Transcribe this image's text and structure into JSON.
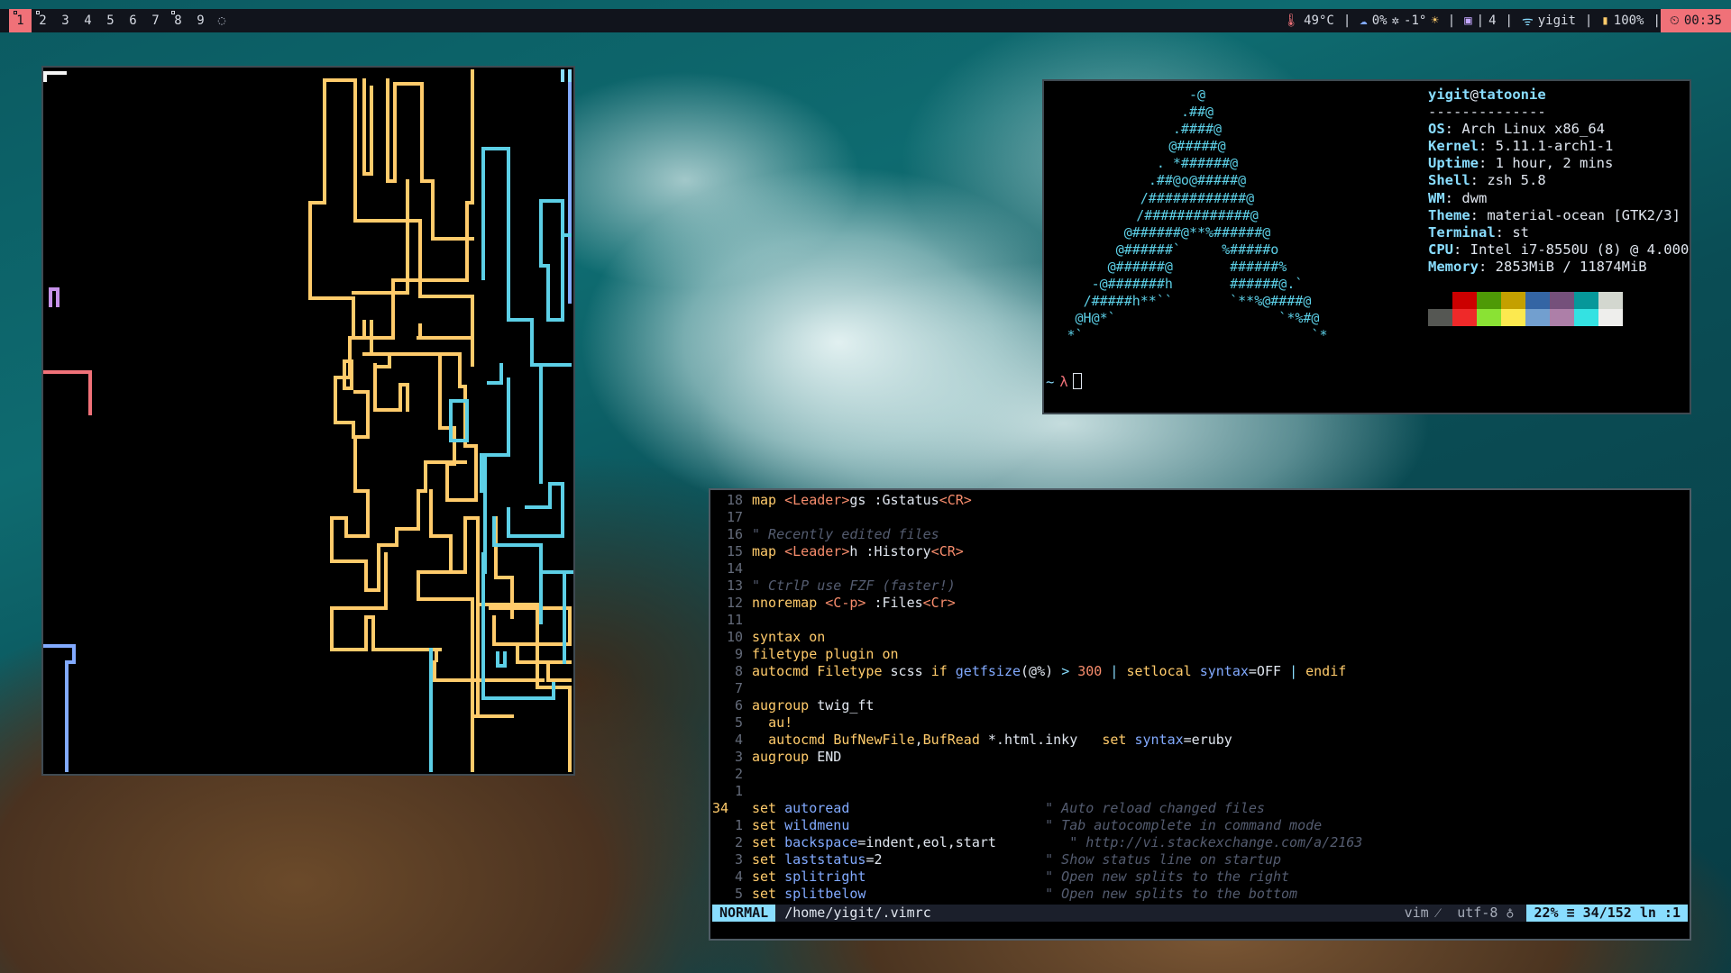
{
  "topbar": {
    "tags": [
      {
        "label": "1",
        "active": true,
        "occupied": true
      },
      {
        "label": "2",
        "active": false,
        "occupied": true
      },
      {
        "label": "3",
        "active": false,
        "occupied": false
      },
      {
        "label": "4",
        "active": false,
        "occupied": false
      },
      {
        "label": "5",
        "active": false,
        "occupied": false
      },
      {
        "label": "6",
        "active": false,
        "occupied": false
      },
      {
        "label": "7",
        "active": false,
        "occupied": false
      },
      {
        "label": "8",
        "active": false,
        "occupied": true
      },
      {
        "label": "9",
        "active": false,
        "occupied": false
      }
    ],
    "layout_symbol": "◌",
    "temp": "49°C",
    "cpu": "0%",
    "weather_temp": "-1°",
    "volume": "4",
    "wifi": "yigit",
    "battery": "100%",
    "clock": "00:35",
    "separator": "|"
  },
  "neofetch": {
    "logo": [
      "-@",
      ".##@",
      ".####@",
      "@#####@",
      ". *######@",
      ".##@o@#####@",
      "/############@",
      "/#############@",
      "@######@**%######@",
      "@######`     %#####o",
      "@######@       ######%",
      "-@#######h       ######@.`",
      "/#####h**``       `**%@####@",
      "@H@*`                    `*%#@",
      "*`                            `*"
    ],
    "user": "yigit",
    "at": "@",
    "host": "tatoonie",
    "underline": "--------------",
    "fields": [
      {
        "key": "OS",
        "value": "Arch Linux x86_64"
      },
      {
        "key": "Kernel",
        "value": "5.11.1-arch1-1"
      },
      {
        "key": "Uptime",
        "value": "1 hour, 2 mins"
      },
      {
        "key": "Shell",
        "value": "zsh 5.8"
      },
      {
        "key": "WM",
        "value": "dwm"
      },
      {
        "key": "Theme",
        "value": "material-ocean [GTK2/3]"
      },
      {
        "key": "Terminal",
        "value": "st"
      },
      {
        "key": "CPU",
        "value": "Intel i7-8550U (8) @ 4.000"
      },
      {
        "key": "Memory",
        "value": "2853MiB / 11874MiB"
      }
    ],
    "palette_top": [
      "#000000",
      "#cc0000",
      "#4e9a06",
      "#c4a000",
      "#3465a4",
      "#75507b",
      "#06989a",
      "#d3d7cf"
    ],
    "palette_bottom": [
      "#555753",
      "#ef2929",
      "#8ae234",
      "#fce94f",
      "#729fcf",
      "#ad7fa8",
      "#34e2e2",
      "#eeeeec"
    ],
    "prompt_dir": "~",
    "prompt_symbol": "λ"
  },
  "vim": {
    "lines": [
      {
        "n": "18",
        "html": "<span class=\"kw\">map</span> <span class=\"spec\">&lt;Leader&gt;</span>gs :Gstatus<span class=\"spec\">&lt;CR&gt;</span>"
      },
      {
        "n": "17",
        "html": ""
      },
      {
        "n": "16",
        "html": "<span class=\"cmt\">\" Recently edited files</span>"
      },
      {
        "n": "15",
        "html": "<span class=\"kw\">map</span> <span class=\"spec\">&lt;Leader&gt;</span>h :History<span class=\"spec\">&lt;CR&gt;</span>"
      },
      {
        "n": "14",
        "html": ""
      },
      {
        "n": "13",
        "html": "<span class=\"cmt\">\" CtrlP use FZF (faster!)</span>"
      },
      {
        "n": "12",
        "html": "<span class=\"kw\">nnoremap</span> <span class=\"spec\">&lt;C-p&gt;</span> :Files<span class=\"spec\">&lt;Cr&gt;</span>"
      },
      {
        "n": "11",
        "html": ""
      },
      {
        "n": "10",
        "html": "<span class=\"kw\">syntax</span> <span class=\"kw\">on</span>"
      },
      {
        "n": "9",
        "html": "<span class=\"kw\">filetype</span> <span class=\"kw\">plugin</span> <span class=\"kw\">on</span>"
      },
      {
        "n": "8",
        "html": "<span class=\"kw\">autocmd</span> <span class=\"fn\">Filetype</span> scss <span class=\"kw\">if</span> <span class=\"var\">getfsize</span>(@%) <span class=\"op\">&gt;</span> <span class=\"num\">300</span> <span class=\"op\">|</span> <span class=\"kw\">setlocal</span> <span class=\"var\">syntax</span>=OFF <span class=\"op\">|</span> <span class=\"kw\">endif</span>"
      },
      {
        "n": "7",
        "html": ""
      },
      {
        "n": "6",
        "html": "<span class=\"kw\">augroup</span> twig_ft"
      },
      {
        "n": "5",
        "html": "  <span class=\"kw\">au!</span>"
      },
      {
        "n": "4",
        "html": "  <span class=\"kw\">autocmd</span> <span class=\"fn\">BufNewFile</span>,<span class=\"fn\">BufRead</span> *.html.inky   <span class=\"kw\">set</span> <span class=\"var\">syntax</span>=eruby"
      },
      {
        "n": "3",
        "html": "<span class=\"kw\">augroup</span> END"
      },
      {
        "n": "2",
        "html": ""
      },
      {
        "n": "1",
        "html": ""
      },
      {
        "n": "34",
        "cur": true,
        "html": "<span class=\"kw\">set</span> <span class=\"var\">autoread</span>                        <span class=\"cmt\">\" Auto reload changed files</span>"
      },
      {
        "n": "1",
        "html": "<span class=\"kw\">set</span> <span class=\"var\">wildmenu</span>                        <span class=\"cmt\">\" Tab autocomplete in command mode</span>"
      },
      {
        "n": "2",
        "html": "<span class=\"kw\">set</span> <span class=\"var\">backspace</span>=indent,eol,start         <span class=\"cmt\">\" http://vi.stackexchange.com/a/2163</span>"
      },
      {
        "n": "3",
        "html": "<span class=\"kw\">set</span> <span class=\"var\">laststatus</span>=2                    <span class=\"cmt\">\" Show status line on startup</span>"
      },
      {
        "n": "4",
        "html": "<span class=\"kw\">set</span> <span class=\"var\">splitright</span>                      <span class=\"cmt\">\" Open new splits to the right</span>"
      },
      {
        "n": "5",
        "html": "<span class=\"kw\">set</span> <span class=\"var\">splitbelow</span>                      <span class=\"cmt\">\" Open new splits to the bottom</span>"
      }
    ],
    "mode": "NORMAL",
    "filename": "/home/yigit/.vimrc",
    "filetype": "vim ⁄",
    "encoding": "utf-8 ♁",
    "position": "22% ≡ 34/152 ln :1"
  }
}
